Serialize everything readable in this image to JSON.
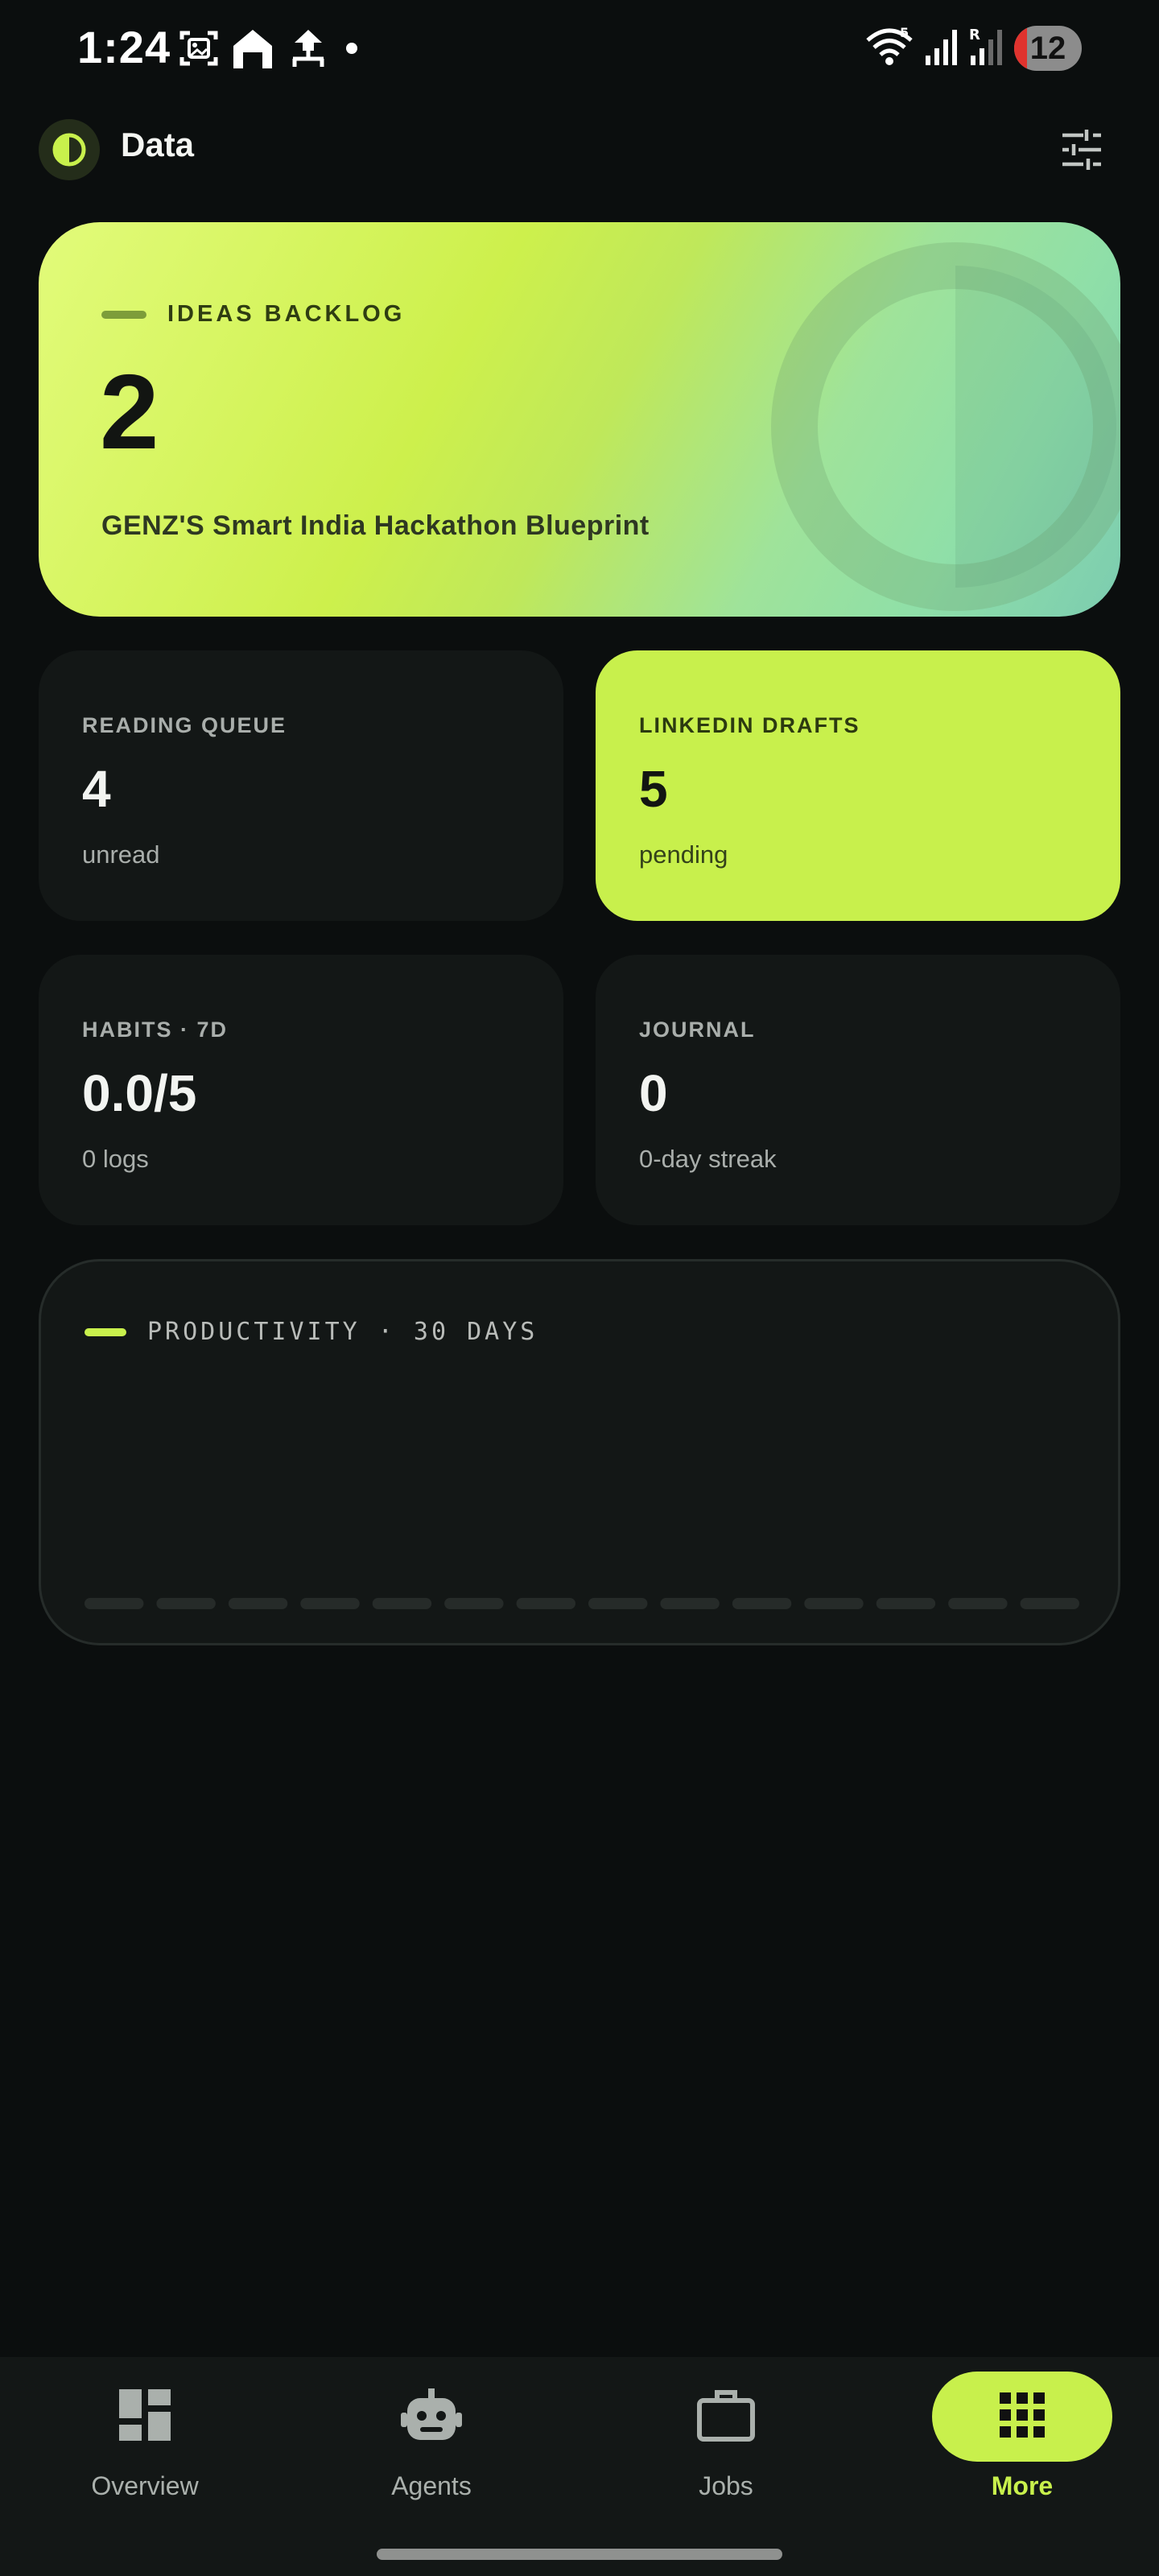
{
  "status_bar": {
    "time": "1:24",
    "battery": "12",
    "left_icons": [
      "screenshot-icon",
      "home-shape-icon",
      "network-tree-icon",
      "notification-dot-icon"
    ],
    "right_icons": [
      "wifi-icon",
      "signal-icon",
      "roaming-signal-icon",
      "battery-icon"
    ]
  },
  "header": {
    "title": "Data",
    "logo_icon": "half-circle-logo-icon",
    "filter_icon": "sliders-icon"
  },
  "hero": {
    "label": "IDEAS BACKLOG",
    "value": "2",
    "subtitle": "GENZ'S Smart India Hackathon Blueprint"
  },
  "stats": {
    "reading": {
      "label": "READING QUEUE",
      "value": "4",
      "sub": "unread"
    },
    "linkedin": {
      "label": "LINKEDIN DRAFTS",
      "value": "5",
      "sub": "pending"
    },
    "habits": {
      "label": "HABITS · 7D",
      "value": "0.0/5",
      "sub": "0 logs"
    },
    "journal": {
      "label": "JOURNAL",
      "value": "0",
      "sub": "0-day streak"
    }
  },
  "productivity": {
    "label": "PRODUCTIVITY · 30 DAYS"
  },
  "chart_data": {
    "type": "bar",
    "title": "PRODUCTIVITY · 30 DAYS",
    "values": [
      0,
      0,
      0,
      0,
      0,
      0,
      0,
      0,
      0,
      0,
      0,
      0,
      0,
      0
    ],
    "bar_color": "#262b29"
  },
  "nav": {
    "items": [
      {
        "label": "Overview",
        "icon": "dashboard-icon",
        "active": false
      },
      {
        "label": "Agents",
        "icon": "robot-icon",
        "active": false
      },
      {
        "label": "Jobs",
        "icon": "briefcase-icon",
        "active": false
      },
      {
        "label": "More",
        "icon": "apps-grid-icon",
        "active": true
      }
    ]
  },
  "colors": {
    "accent": "#c8f04c",
    "background": "#0b0e0e",
    "card": "#131716"
  }
}
